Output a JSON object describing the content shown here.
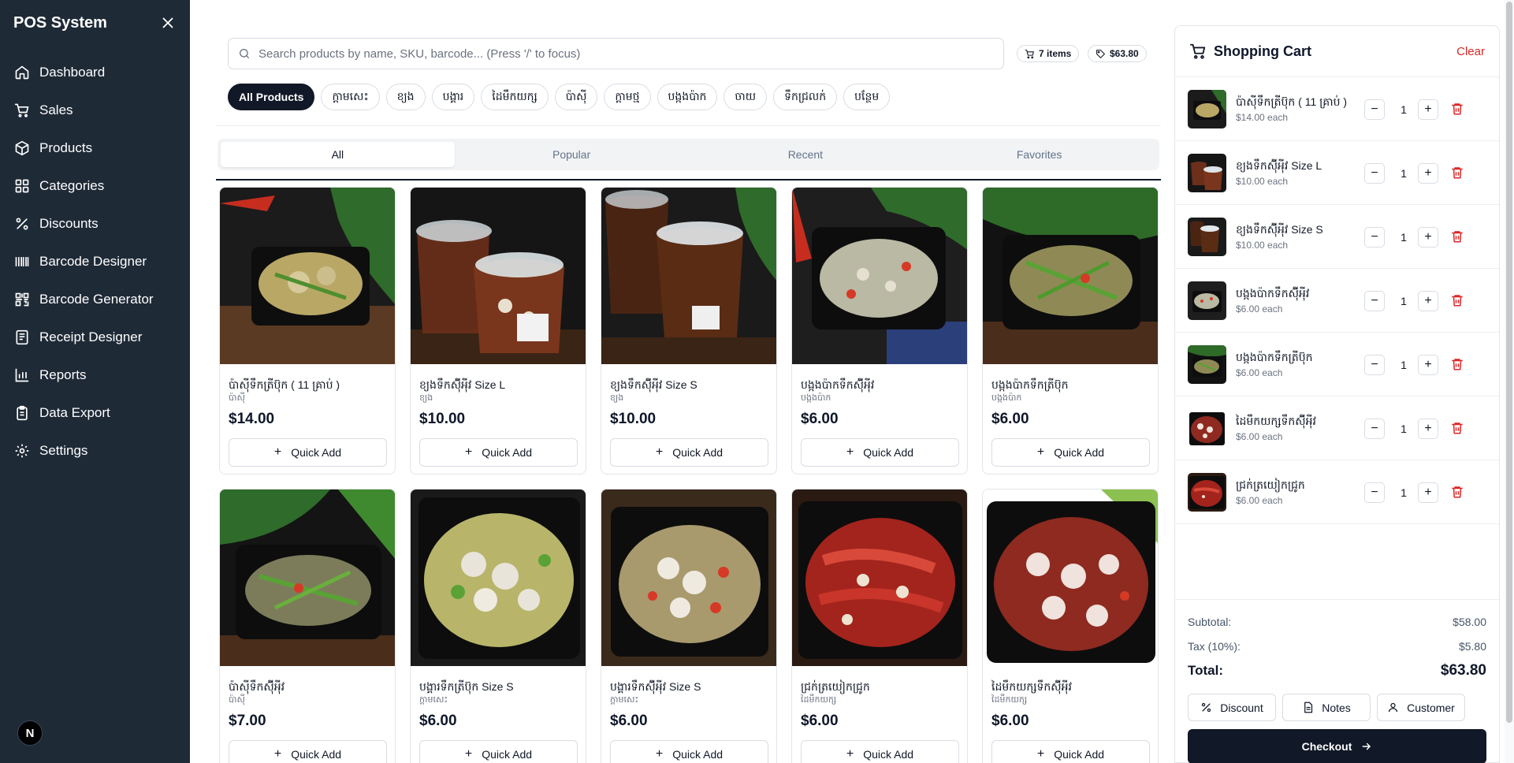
{
  "app": {
    "title": "POS System"
  },
  "sidebar": {
    "items": [
      {
        "label": "Dashboard",
        "icon": "home-icon"
      },
      {
        "label": "Sales",
        "icon": "cart-icon"
      },
      {
        "label": "Products",
        "icon": "package-icon"
      },
      {
        "label": "Categories",
        "icon": "grid-icon"
      },
      {
        "label": "Discounts",
        "icon": "percent-icon"
      },
      {
        "label": "Barcode Designer",
        "icon": "barcode-icon"
      },
      {
        "label": "Barcode Generator",
        "icon": "scan-icon"
      },
      {
        "label": "Receipt Designer",
        "icon": "receipt-icon"
      },
      {
        "label": "Reports",
        "icon": "chart-icon"
      },
      {
        "label": "Data Export",
        "icon": "clipboard-icon"
      },
      {
        "label": "Settings",
        "icon": "gear-icon"
      }
    ],
    "avatar_letter": "N"
  },
  "search": {
    "placeholder": "Search products by name, SKU, barcode... (Press '/' to focus)"
  },
  "badges": {
    "items": "7 items",
    "total": "$63.80"
  },
  "categories": [
    "All Products",
    "ក្តាមសេះ",
    "ខ្យង",
    "បង្គារ",
    "ដៃមឹកយក្ស",
    "ប៉ាសុី",
    "ក្តាមថ្ម",
    "បង្កងប៉ាក",
    "ចាយ",
    "ទឹកជ្រលក់",
    "បន្ថែម"
  ],
  "tabs": [
    "All",
    "Popular",
    "Recent",
    "Favorites"
  ],
  "quick_add_label": "Quick Add",
  "products": [
    {
      "name": "ប៉ាសុីទឹកត្រីប៊ុក ( 11 គ្រាប់ )",
      "category": "ប៉ាសុី",
      "price": "$14.00"
    },
    {
      "name": "ខ្យងទឹកស៊ុីអុីវ Size L",
      "category": "ខ្យង",
      "price": "$10.00"
    },
    {
      "name": "ខ្យងទឹកស៊ុីអុីវ Size S",
      "category": "ខ្យង",
      "price": "$10.00"
    },
    {
      "name": "បង្កងប៉ាកទឹកស៊ុីអុីវ",
      "category": "បង្កងប៉ាក",
      "price": "$6.00"
    },
    {
      "name": "បង្កងប៉ាកទឹកត្រីប៊ុក",
      "category": "បង្កងប៉ាក",
      "price": "$6.00"
    },
    {
      "name": "ប៉ាសុីទឹកស៊ុីអុីវ",
      "category": "ប៉ាសុី",
      "price": "$7.00"
    },
    {
      "name": "បង្គារទឹកត្រីប៊ុក Size S",
      "category": "ក្តាមសេះ",
      "price": "$6.00"
    },
    {
      "name": "បង្គារទឹកស៊ុីអុីវ Size S",
      "category": "ក្តាមសេះ",
      "price": "$6.00"
    },
    {
      "name": "ជ្រក់ត្រយៀកជ្រូក",
      "category": "ដៃមឹកយក្ស",
      "price": "$6.00"
    },
    {
      "name": "ដៃមឹកយក្សទឹកស៊ុីអុីវ",
      "category": "ដៃមឹកយក្ស",
      "price": "$6.00"
    }
  ],
  "cart": {
    "title": "Shopping Cart",
    "clear_label": "Clear",
    "items": [
      {
        "name": "ប៉ាសុីទឹកត្រីប៊ុក ( 11 គ្រាប់ )",
        "each": "$14.00 each",
        "qty": "1"
      },
      {
        "name": "ខ្យងទឹកស៊ុីអុីវ Size L",
        "each": "$10.00 each",
        "qty": "1"
      },
      {
        "name": "ខ្យងទឹកស៊ុីអុីវ Size S",
        "each": "$10.00 each",
        "qty": "1"
      },
      {
        "name": "បង្កងប៉ាកទឹកស៊ុីអុីវ",
        "each": "$6.00 each",
        "qty": "1"
      },
      {
        "name": "បង្កងប៉ាកទឹកត្រីប៊ុក",
        "each": "$6.00 each",
        "qty": "1"
      },
      {
        "name": "ដៃមឹកយក្សទឹកស៊ុីអុីវ",
        "each": "$6.00 each",
        "qty": "1"
      },
      {
        "name": "ជ្រក់ត្រយៀកជ្រូក",
        "each": "$6.00 each",
        "qty": "1"
      }
    ],
    "subtotal_label": "Subtotal:",
    "subtotal": "$58.00",
    "tax_label": "Tax (10%):",
    "tax": "$5.80",
    "total_label": "Total:",
    "total": "$63.80",
    "discount_label": "Discount",
    "notes_label": "Notes",
    "customer_label": "Customer",
    "checkout_label": "Checkout"
  },
  "colors": {
    "sidebar_bg": "#1f2a37",
    "primary": "#111827",
    "danger": "#dc2626"
  }
}
